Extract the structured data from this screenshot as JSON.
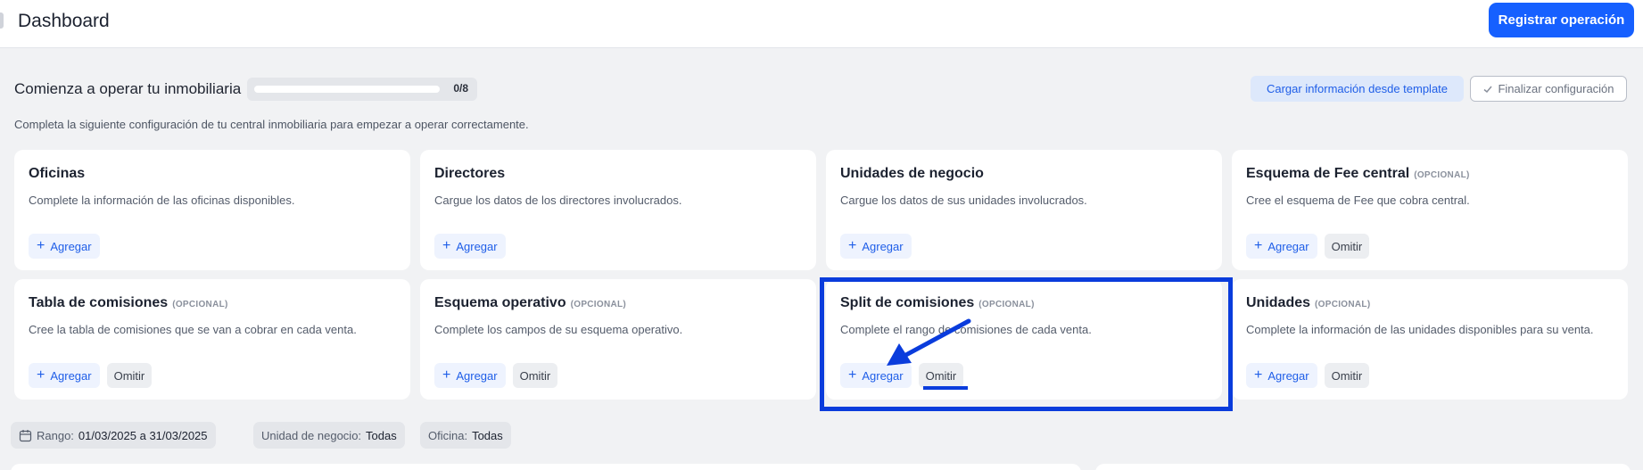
{
  "header": {
    "title": "Dashboard",
    "primary_button": "Registrar operación"
  },
  "onboarding": {
    "title": "Comienza a operar tu inmobiliaria",
    "progress_text": "0/8",
    "progress_fraction": 0,
    "template_button": "Cargar información desde template",
    "finalize_button": "Finalizar configuración",
    "subtitle": "Completa la siguiente configuración de tu central inmobiliaria para empezar a operar correctamente."
  },
  "cards": {
    "oficinas": {
      "title": "Oficinas",
      "description": "Complete la información de las oficinas disponibles.",
      "add": "Agregar"
    },
    "directores": {
      "title": "Directores",
      "description": "Cargue los datos de los directores involucrados.",
      "add": "Agregar"
    },
    "unidades_negocio": {
      "title": "Unidades de negocio",
      "description": "Cargue los datos de sus unidades involucrados.",
      "add": "Agregar"
    },
    "esquema_fee": {
      "title": "Esquema de Fee central",
      "optional": "(OPCIONAL)",
      "description": "Cree el esquema de Fee que cobra central.",
      "add": "Agregar",
      "skip": "Omitir"
    },
    "tabla_comisiones": {
      "title": "Tabla de comisiones",
      "optional": "(OPCIONAL)",
      "description": "Cree la tabla de comisiones que se van a cobrar en cada venta.",
      "add": "Agregar",
      "skip": "Omitir"
    },
    "esquema_operativo": {
      "title": "Esquema operativo",
      "optional": "(OPCIONAL)",
      "description": "Complete los campos de su esquema operativo.",
      "add": "Agregar",
      "skip": "Omitir"
    },
    "split_comisiones": {
      "title": "Split de comisiones",
      "optional": "(OPCIONAL)",
      "description": "Complete el rango de comisiones de cada venta.",
      "add": "Agregar",
      "skip": "Omitir"
    },
    "unidades": {
      "title": "Unidades",
      "optional": "(OPCIONAL)",
      "description": "Complete la información de las unidades disponibles para su venta.",
      "add": "Agregar",
      "skip": "Omitir"
    }
  },
  "filters": {
    "range_label": "Rango:",
    "range_value": "01/03/2025 a 31/03/2025",
    "unit_label": "Unidad de negocio:",
    "unit_value": "Todas",
    "office_label": "Oficina:",
    "office_value": "Todas"
  },
  "colors": {
    "accent": "#1660ff",
    "annotation": "#0a3cdc"
  }
}
